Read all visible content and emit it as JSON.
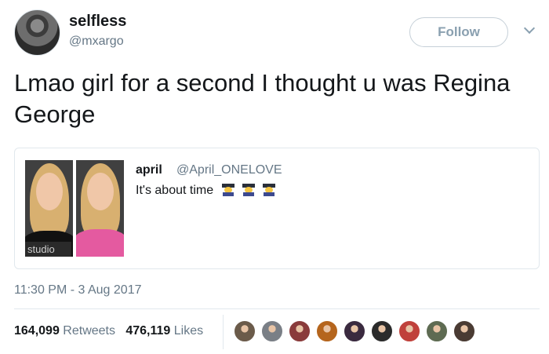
{
  "author": {
    "name": "selfless",
    "handle": "@mxargo",
    "follow_label": "Follow"
  },
  "tweet": {
    "text": "Lmao girl for a second I thought u was Regina George"
  },
  "quoted": {
    "name": "april",
    "handle": "@April_ONELOVE",
    "text": "It's about time",
    "emojis": [
      "graduate-emoji",
      "graduate-emoji",
      "graduate-emoji"
    ],
    "photo_watermark": "studio"
  },
  "meta": {
    "timestamp": "11:30 PM - 3 Aug 2017"
  },
  "stats": {
    "retweets_count": "164,099",
    "retweets_label": "Retweets",
    "likes_count": "476,119",
    "likes_label": "Likes"
  },
  "likers": [
    {
      "color": "#6b5b4a"
    },
    {
      "color": "#7a7f86"
    },
    {
      "color": "#8a3b3b"
    },
    {
      "color": "#b5651d"
    },
    {
      "color": "#3a2a3f"
    },
    {
      "color": "#2b2b2b"
    },
    {
      "color": "#c0413b"
    },
    {
      "color": "#5e6b52"
    },
    {
      "color": "#4a3b33"
    }
  ]
}
